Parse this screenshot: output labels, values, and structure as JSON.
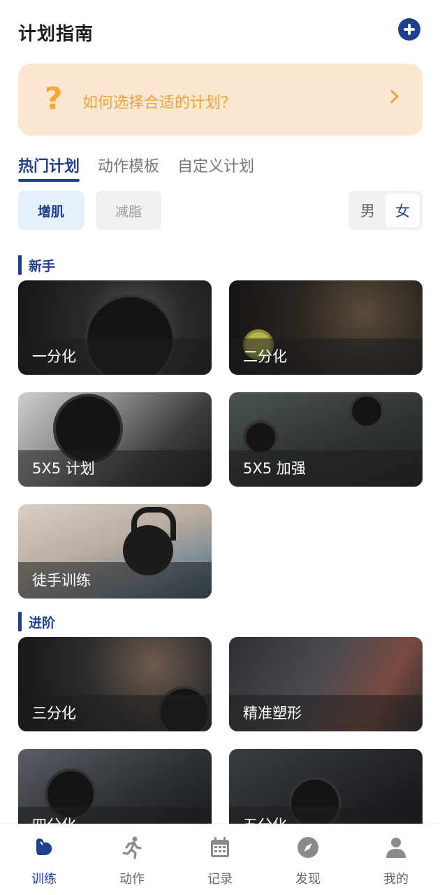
{
  "header": {
    "title": "计划指南"
  },
  "guide": {
    "text": "如何选择合适的计划？"
  },
  "tabs": [
    {
      "label": "热门计划",
      "active": true
    },
    {
      "label": "动作模板",
      "active": false
    },
    {
      "label": "自定义计划",
      "active": false
    }
  ],
  "filters": {
    "gain": "增肌",
    "cut": "减脂"
  },
  "gender": {
    "male": "男",
    "female": "女",
    "selected": "女"
  },
  "sections": {
    "beginner": {
      "title": "新手",
      "plans": [
        "一分化",
        "二分化",
        "5X5 计划",
        "5X5 加强",
        "徒手训练"
      ]
    },
    "advanced": {
      "title": "进阶",
      "plans": [
        "三分化",
        "精准塑形",
        "四分化",
        "五分化"
      ]
    }
  },
  "tabbar": [
    {
      "label": "训练",
      "icon": "muscle-arm-icon",
      "active": true
    },
    {
      "label": "动作",
      "icon": "running-person-icon",
      "active": false
    },
    {
      "label": "记录",
      "icon": "calendar-icon",
      "active": false
    },
    {
      "label": "发现",
      "icon": "compass-icon",
      "active": false
    },
    {
      "label": "我的",
      "icon": "person-icon",
      "active": false
    }
  ],
  "colors": {
    "accent": "#1f3f8f",
    "guide_bg": "#fbe7cf",
    "guide_text": "#e8a43e"
  }
}
